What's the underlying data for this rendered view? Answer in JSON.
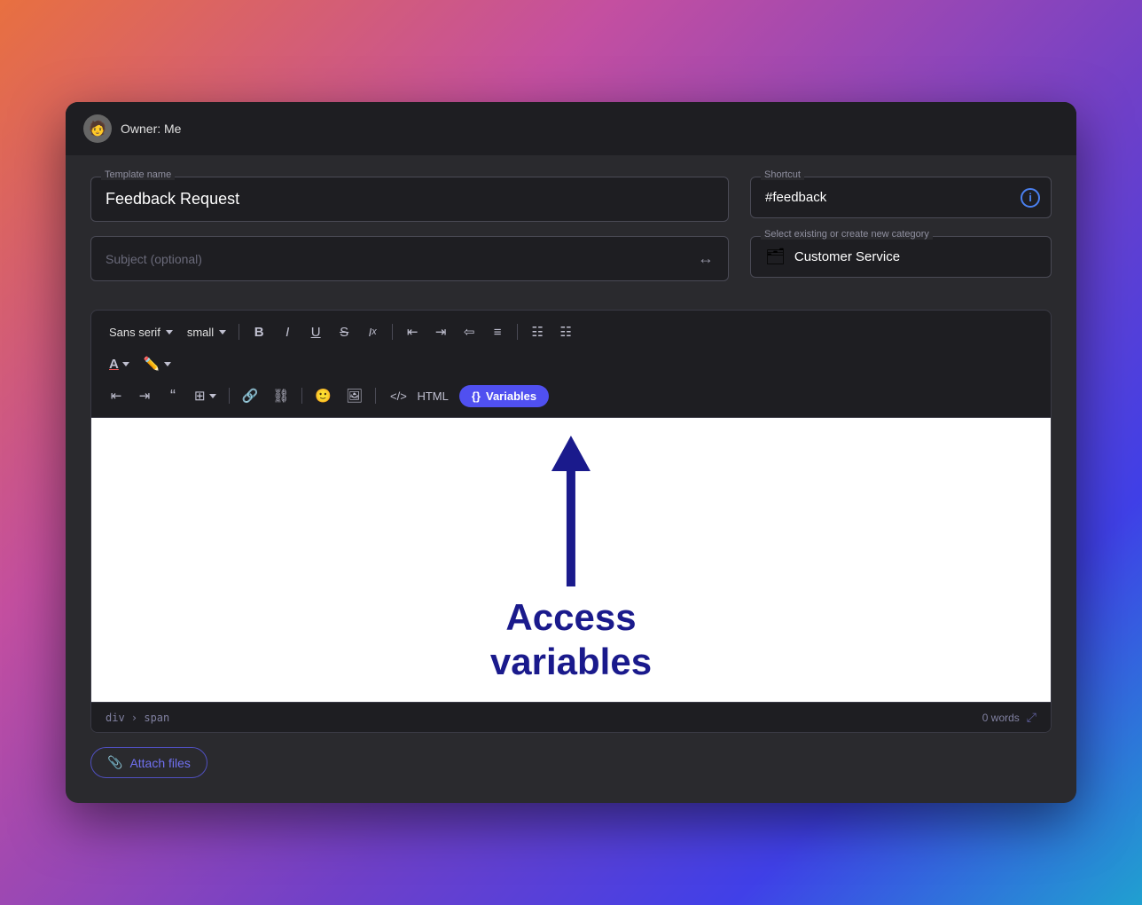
{
  "titlebar": {
    "owner_label": "Owner: Me",
    "avatar_emoji": "👤"
  },
  "template_name_field": {
    "label": "Template name",
    "value": "Feedback Request"
  },
  "subject_field": {
    "placeholder": "Subject (optional)"
  },
  "shortcut_field": {
    "label": "Shortcut",
    "value": "#feedback"
  },
  "category_field": {
    "label": "Select existing or create new category",
    "value": "Customer Service",
    "icon": "📁"
  },
  "toolbar": {
    "font_family": "Sans serif",
    "font_size": "small",
    "bold": "B",
    "italic": "I",
    "underline": "U",
    "strikethrough": "S",
    "clear_format": "𝐼",
    "align_left": "≡",
    "align_center": "≡",
    "align_right": "≡",
    "align_justify": "≡",
    "list_bullet": "•≡",
    "list_ordered": "1≡",
    "font_color": "A",
    "highlight": "🖊",
    "outdent": "⇤",
    "indent": "⇥",
    "blockquote": "\"",
    "table": "⊞",
    "link": "🔗",
    "unlink": "⛓",
    "emoji": "🙂",
    "image": "🖼",
    "html_btn": "HTML",
    "variables_btn": "Variables",
    "variables_icon": "{}"
  },
  "editor": {
    "content": "",
    "annotation_text": "Access\nvariables"
  },
  "status_bar": {
    "breadcrumb": "div › span",
    "word_count": "0 words"
  },
  "attach_files_btn": {
    "label": "Attach files",
    "icon": "📎"
  }
}
